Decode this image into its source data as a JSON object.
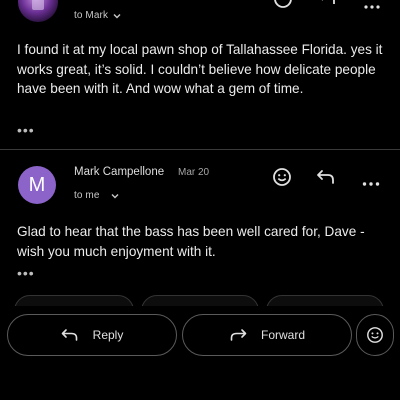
{
  "message1": {
    "recipients": "to Mark",
    "body": "I found it at my local pawn shop of Tallahassee Florida. yes it works great, it’s solid. I couldn’t believe how delicate people have been with it. And wow what a gem of time.",
    "more": "•••"
  },
  "message2": {
    "avatar_letter": "M",
    "avatar_color": "#8b63c9",
    "sender": "Mark Campellone",
    "date": "Mar 20",
    "recipients": "to me",
    "body": "Glad to hear that the bass has been well cared for, Dave - wish you much enjoyment with it.",
    "more": "•••"
  },
  "actions": {
    "reply_label": "Reply",
    "forward_label": "Forward"
  },
  "icons": [
    "emoji-icon",
    "reply-icon",
    "more-vert-icon",
    "chevron-down-icon",
    "forward-icon",
    "add-reaction-icon"
  ]
}
